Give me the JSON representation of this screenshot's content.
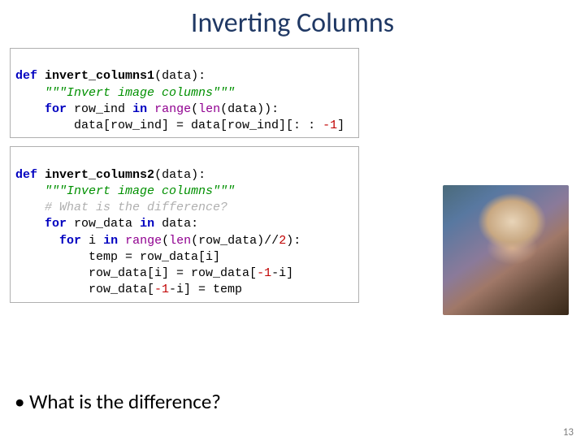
{
  "title": "Inverting Columns",
  "code1": {
    "def": "def",
    "name": "invert_columns1",
    "args": "(data):",
    "doc": "\"\"\"Invert image columns\"\"\"",
    "for": "for",
    "var1": "row_ind",
    "in": "in",
    "range": "range",
    "len": "len",
    "dataexpr": "(data)):",
    "body1a": "data[row_ind] = data[row_ind][: : ",
    "neg1": "-1",
    "body1b": "]"
  },
  "code2": {
    "def": "def",
    "name": "invert_columns2",
    "args": "(data):",
    "doc": "\"\"\"Invert image columns\"\"\"",
    "comment": "# What is the difference?",
    "for": "for",
    "var1": "row_data",
    "in": "in",
    "data": "data:",
    "for2": "for",
    "var2": "i",
    "in2": "in",
    "range": "range",
    "len": "len",
    "rowdata": "(row_data)//",
    "two": "2",
    "close": "):",
    "l1": "temp = row_data[i]",
    "l2a": "row_data[i] = row_data[",
    "neg1": "-1",
    "l2b": "-i]",
    "l3a": "row_data[",
    "l3b": "-i] = temp"
  },
  "bullet": "• What is the difference?",
  "pagenum": "13",
  "image_alt": "Lena reference image (woman with hat)"
}
